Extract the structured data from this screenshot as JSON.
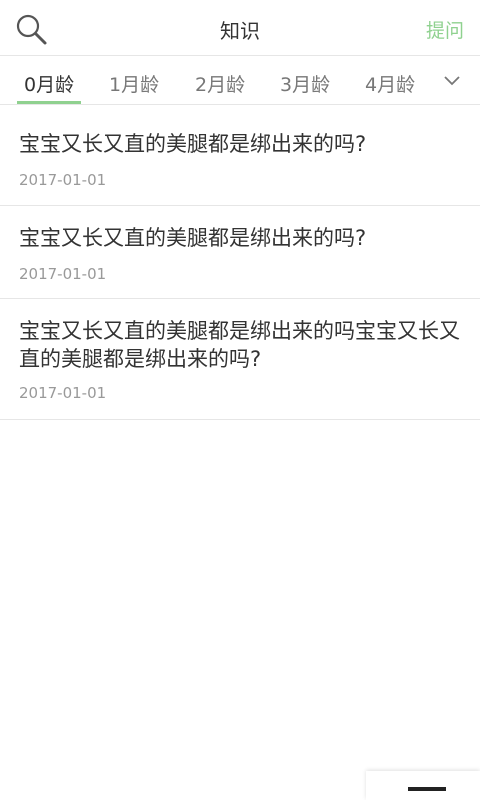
{
  "header": {
    "title": "知识",
    "ask_label": "提问",
    "search_icon": "search-icon",
    "accent_color": "#8fd18f"
  },
  "tabs": [
    {
      "label": "0月龄",
      "active": true
    },
    {
      "label": "1月龄",
      "active": false
    },
    {
      "label": "2月龄",
      "active": false
    },
    {
      "label": "3月龄",
      "active": false
    },
    {
      "label": "4月龄",
      "active": false
    }
  ],
  "tabs_expand_icon": "chevron-down-icon",
  "articles": [
    {
      "title": "宝宝又长又直的美腿都是绑出来的吗?",
      "date": "2017-01-01"
    },
    {
      "title": "宝宝又长又直的美腿都是绑出来的吗?",
      "date": "2017-01-01"
    },
    {
      "title": "宝宝又长又直的美腿都是绑出来的吗宝宝又长又直的美腿都是绑出来的吗?",
      "date": "2017-01-01"
    }
  ]
}
